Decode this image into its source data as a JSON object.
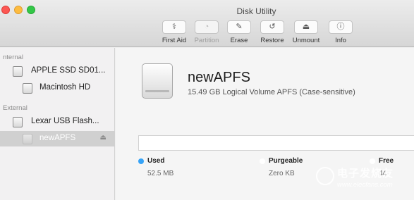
{
  "window": {
    "title": "Disk Utility"
  },
  "toolbar": {
    "items": [
      {
        "label": "First Aid",
        "icon": "stethoscope-icon",
        "glyph": "⚕",
        "enabled": true
      },
      {
        "label": "Partition",
        "icon": "pie-icon",
        "glyph": "◔",
        "enabled": false
      },
      {
        "label": "Erase",
        "icon": "erase-icon",
        "glyph": "✎",
        "enabled": true
      },
      {
        "label": "Restore",
        "icon": "restore-icon",
        "glyph": "↺",
        "enabled": true
      },
      {
        "label": "Unmount",
        "icon": "unmount-icon",
        "glyph": "⏏",
        "enabled": true
      },
      {
        "label": "Info",
        "icon": "info-icon",
        "glyph": "ⓘ",
        "enabled": true
      }
    ]
  },
  "sidebar": {
    "internal_header": "nternal",
    "external_header": "External",
    "items": [
      {
        "name": "APPLE SSD SD01...",
        "icon": "disk-icon"
      },
      {
        "name": "Macintosh HD",
        "icon": "volume-icon"
      },
      {
        "name": "Lexar USB Flash...",
        "icon": "disk-icon"
      },
      {
        "name": "newAPFS",
        "icon": "volume-icon",
        "selected": true,
        "eject": "⏏"
      }
    ]
  },
  "volume": {
    "name": "newAPFS",
    "description": "15.49 GB Logical Volume APFS (Case-sensitive)",
    "icon": "drive-icon"
  },
  "usage": [
    {
      "title": "Used",
      "value": "52.5 MB",
      "color": "#36a3f7"
    },
    {
      "title": "Purgeable",
      "value": "Zero KB",
      "color": "#ffffff"
    },
    {
      "title": "Free",
      "value": "44",
      "color": "#ffffff"
    }
  ],
  "watermark": {
    "text1": "电子发烧友",
    "text2": "www.elecfans.com"
  }
}
